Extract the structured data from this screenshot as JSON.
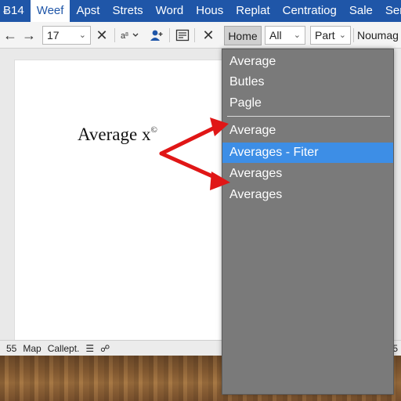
{
  "menubar": {
    "tabs": [
      {
        "label": "Ƀ14"
      },
      {
        "label": "Weef",
        "active": true
      },
      {
        "label": "Apst"
      },
      {
        "label": "Strets"
      },
      {
        "label": "Word"
      },
      {
        "label": "Hous"
      },
      {
        "label": "Replat"
      },
      {
        "label": "Centratiog"
      },
      {
        "label": "Sale"
      },
      {
        "label": "Ser"
      }
    ]
  },
  "toolbar": {
    "back_icon": "arrow-left-icon",
    "forward_icon": "arrow-right-icon",
    "font_size_value": "17",
    "home_label": "Home",
    "filter_all_value": "All",
    "part_value": "Part",
    "numag_label": "Noumag"
  },
  "document": {
    "text": "Average x",
    "superscript": "©"
  },
  "dropdown": {
    "items": [
      {
        "label": "Average"
      },
      {
        "label": "Butles"
      },
      {
        "label": "Pagle"
      },
      {
        "label": "Average"
      },
      {
        "label": "Averages - Fiter",
        "selected": true
      },
      {
        "label": "Averages"
      },
      {
        "label": "Averages"
      }
    ]
  },
  "statusbar": {
    "page_num": "55",
    "map_label": "Map",
    "calleptal_label": "Callept.",
    "right_num": "5"
  },
  "colors": {
    "menubar_bg": "#1f56a8",
    "dropdown_bg": "#7a7a7a",
    "selection": "#3d8ee6",
    "arrow": "#e01616"
  }
}
